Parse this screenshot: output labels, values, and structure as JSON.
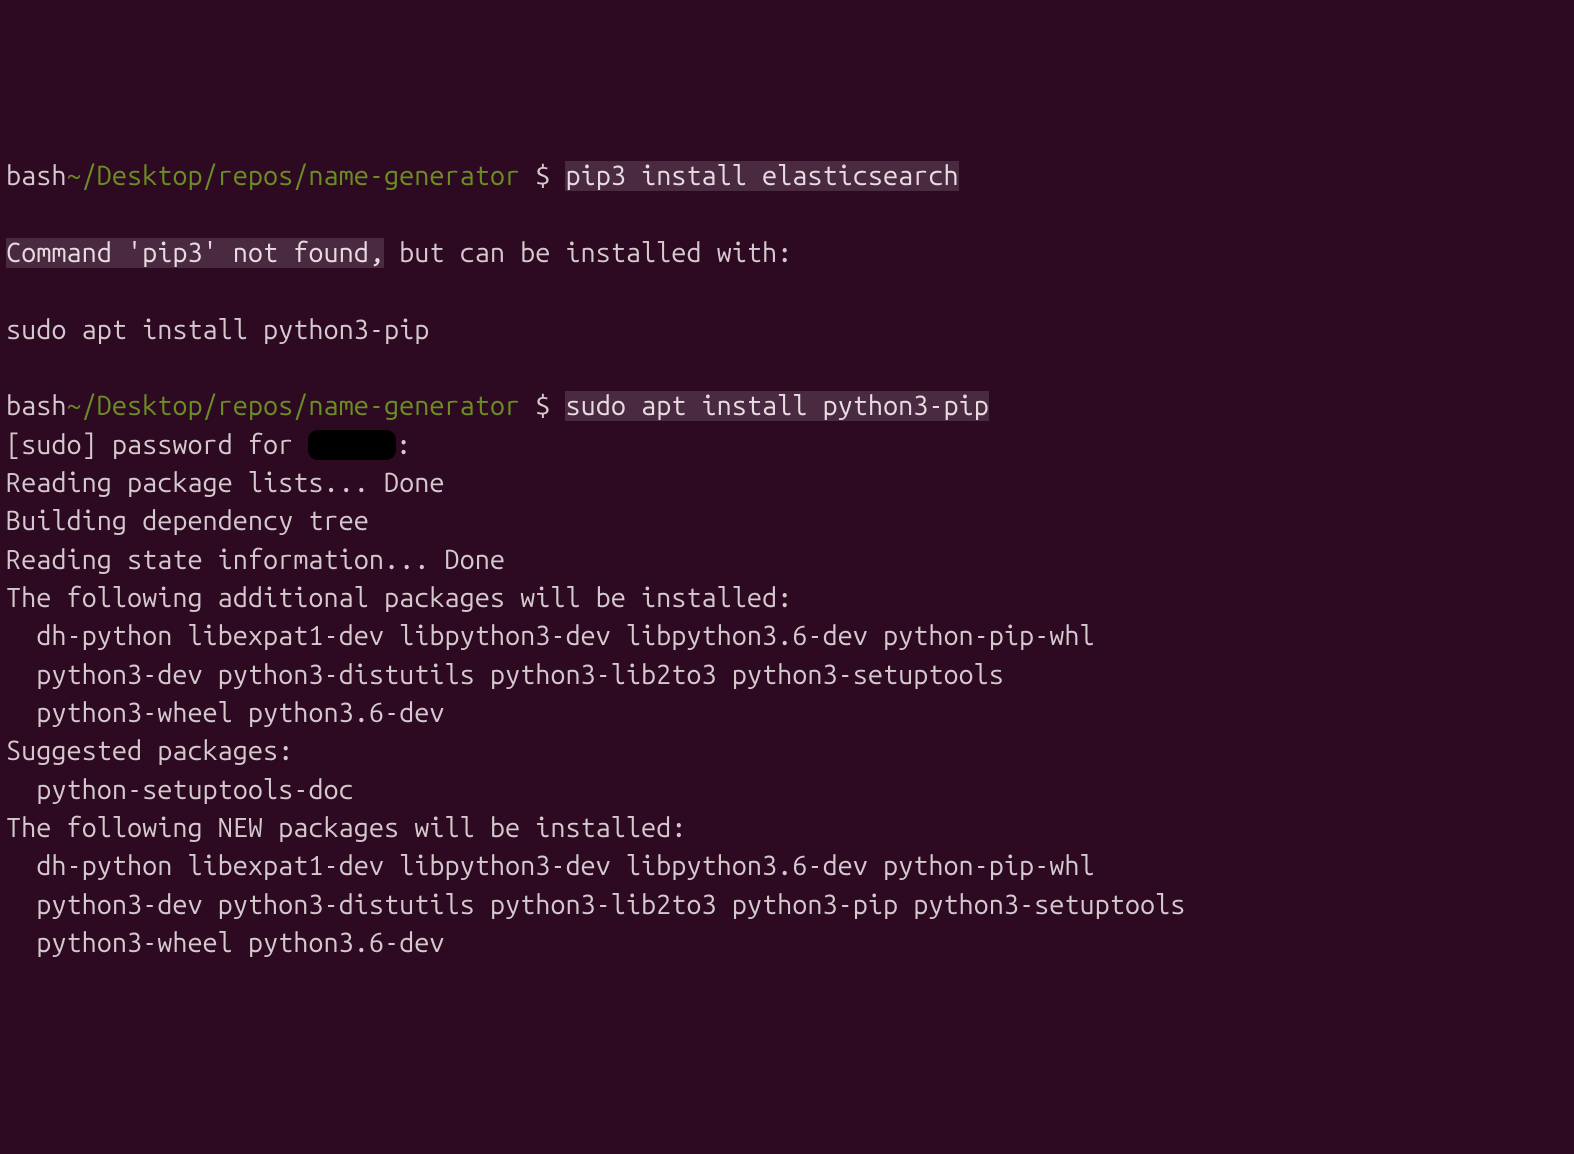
{
  "prompt1": {
    "shell": "bash",
    "path": "~/Desktop/repos/name-generator",
    "dollar": " $ ",
    "command": "pip3 install elasticsearch"
  },
  "error": {
    "highlighted": "Command 'pip3' not found,",
    "rest": " but can be installed with:"
  },
  "suggestion": "sudo apt install python3-pip",
  "prompt2": {
    "shell": "bash",
    "path": "~/Desktop/repos/name-generator",
    "dollar": " $ ",
    "command": "sudo apt install python3-pip"
  },
  "sudo_line_prefix": "[sudo] password for ",
  "redacted_user": "xxxxx",
  "sudo_line_suffix": ":",
  "apt_output": {
    "line1": "Reading package lists... Done",
    "line2": "Building dependency tree",
    "line3": "Reading state information... Done",
    "line4": "The following additional packages will be installed:",
    "line5": "  dh-python libexpat1-dev libpython3-dev libpython3.6-dev python-pip-whl",
    "line6": "  python3-dev python3-distutils python3-lib2to3 python3-setuptools",
    "line7": "  python3-wheel python3.6-dev",
    "line8": "Suggested packages:",
    "line9": "  python-setuptools-doc",
    "line10": "The following NEW packages will be installed:",
    "line11": "  dh-python libexpat1-dev libpython3-dev libpython3.6-dev python-pip-whl",
    "line12": "  python3-dev python3-distutils python3-lib2to3 python3-pip python3-setuptools",
    "line13": "  python3-wheel python3.6-dev"
  }
}
